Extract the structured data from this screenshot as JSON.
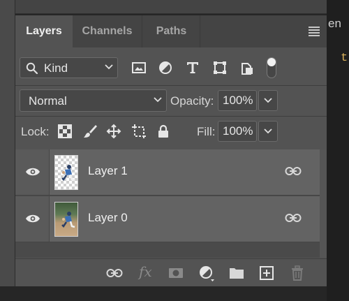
{
  "background_text": {
    "top": "en",
    "glyph": "t"
  },
  "tabs": [
    {
      "label": "Layers",
      "active": true
    },
    {
      "label": "Channels",
      "active": false
    },
    {
      "label": "Paths",
      "active": false
    }
  ],
  "filter": {
    "kind_label": "Kind",
    "icons": [
      "image-filter-icon",
      "adjustment-filter-icon",
      "type-filter-icon",
      "shape-filter-icon",
      "smart-object-filter-icon"
    ],
    "filter_toggle": "on"
  },
  "blend": {
    "mode": "Normal",
    "opacity_label": "Opacity:",
    "opacity_value": "100%"
  },
  "lock": {
    "label": "Lock:",
    "icons": [
      "lock-transparent-pixels-icon",
      "lock-image-pixels-icon",
      "lock-position-icon",
      "prevent-auto-nesting-icon",
      "lock-all-icon"
    ],
    "fill_label": "Fill:",
    "fill_value": "100%"
  },
  "layers": [
    {
      "name": "Layer 1",
      "visible": true,
      "thumbnail": "transparent"
    },
    {
      "name": "Layer 0",
      "visible": true,
      "thumbnail": "photo"
    }
  ],
  "bottom_icons": [
    "link-layers-icon",
    "fx-icon",
    "add-mask-icon",
    "new-adjustment-layer-icon",
    "new-group-icon",
    "new-layer-icon",
    "delete-layer-icon"
  ],
  "colors": {
    "panel_bg": "#535353",
    "tab_bar_bg": "#444444",
    "layer_row_bg": "#636363",
    "field_bg": "#474747"
  }
}
